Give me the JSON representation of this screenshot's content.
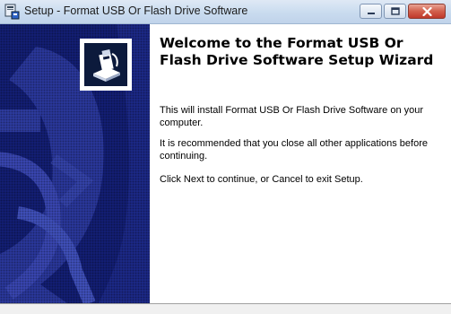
{
  "window": {
    "title": "Setup - Format USB Or Flash Drive Software",
    "app_icon": "setup-icon",
    "controls": [
      "minimize-icon",
      "maximize-icon",
      "close-icon"
    ]
  },
  "sidebar": {
    "background_color": "#14207a",
    "accent_color": "#3b49b8",
    "logo_icon": "usb-drive-icon"
  },
  "content": {
    "heading": "Welcome to the Format USB Or Flash Drive Software Setup Wizard",
    "paragraphs": [
      "This will install Format USB Or Flash Drive Software on your computer.",
      "It is recommended that you close all other applications before continuing.",
      "Click Next to continue, or Cancel to exit Setup."
    ]
  }
}
